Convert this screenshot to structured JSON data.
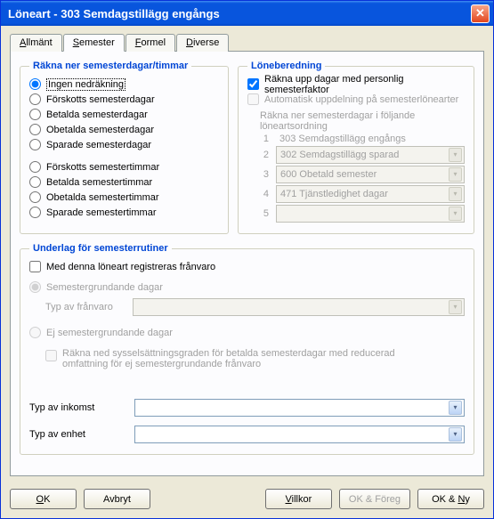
{
  "window": {
    "title": "Löneart - 303  Semdagstillägg engångs"
  },
  "tabs": {
    "allmant": "Allmänt",
    "semester": "Semester",
    "formel": "Formel",
    "diverse": "Diverse"
  },
  "group_rakna": {
    "legend": "Räkna ner semesterdagar/timmar",
    "opts": {
      "ingen": "Ingen nedräkning",
      "forskott_dagar": "Förskotts semesterdagar",
      "betalda_dagar": "Betalda semesterdagar",
      "obetalda_dagar": "Obetalda semesterdagar",
      "sparade_dagar": "Sparade semesterdagar",
      "forskott_timmar": "Förskotts semestertimmar",
      "betalda_timmar": "Betalda semestertimmar",
      "obetalda_timmar": "Obetalda semestertimmar",
      "sparade_timmar": "Sparade semestertimmar"
    }
  },
  "group_loneberedning": {
    "legend": "Löneberedning",
    "rakna_upp": "Räkna upp dagar med personlig semesterfaktor",
    "automatisk": "Automatisk uppdelning på semesterlönearter",
    "ordning_label": "Räkna ner semesterdagar i följande löneartsordning",
    "rows": {
      "1": {
        "num": "1",
        "val": "303 Semdagstillägg engångs"
      },
      "2": {
        "num": "2",
        "val": "302 Semdagstillägg sparad"
      },
      "3": {
        "num": "3",
        "val": "600 Obetald semester"
      },
      "4": {
        "num": "4",
        "val": "471 Tjänstledighet dagar"
      },
      "5": {
        "num": "5",
        "val": ""
      }
    }
  },
  "group_underlag": {
    "legend": "Underlag för semesterrutiner",
    "med_denna": "Med denna löneart registreras frånvaro",
    "semgrund": "Semestergrundande dagar",
    "typ_franvaro_lbl": "Typ av frånvaro",
    "ej_semgrund": "Ej semestergrundande dagar",
    "rakna_ned": "Räkna ned sysselsättningsgraden för betalda semesterdagar med reducerad omfattning för ej semestergrundande frånvaro",
    "typ_inkomst_lbl": "Typ av inkomst",
    "typ_enhet_lbl": "Typ av enhet"
  },
  "buttons": {
    "ok": "OK",
    "avbryt": "Avbryt",
    "villkor": "Villkor",
    "ok_foreg": "OK & Föreg",
    "ok_ny": "OK & Ny"
  }
}
